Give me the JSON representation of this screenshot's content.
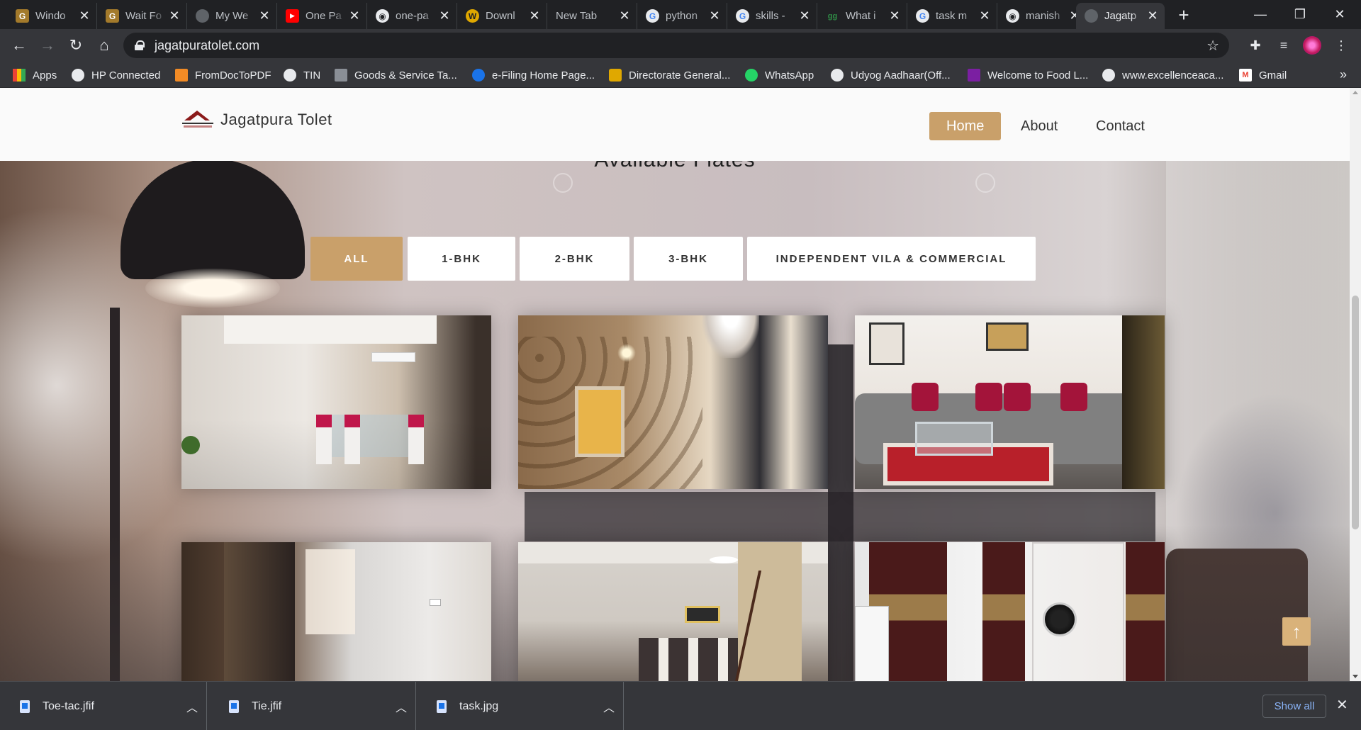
{
  "browser": {
    "tabs": [
      {
        "label": "Windo",
        "favicon_text": "G",
        "favicon_color": "#a37a2b"
      },
      {
        "label": "Wait Fo",
        "favicon_text": "G",
        "favicon_color": "#a37a2b"
      },
      {
        "label": "My We",
        "favicon_text": "",
        "favicon_color": "#5f6368"
      },
      {
        "label": "One Pa",
        "favicon_text": "▶",
        "favicon_color": "#ff0000"
      },
      {
        "label": "one-pa",
        "favicon_text": "◉",
        "favicon_color": "#202124"
      },
      {
        "label": "Downl",
        "favicon_text": "W",
        "favicon_color": "#e0a800"
      },
      {
        "label": "New Tab",
        "favicon_text": "",
        "favicon_color": "transparent"
      },
      {
        "label": "python",
        "favicon_text": "G",
        "favicon_color": "#4285f4"
      },
      {
        "label": "skills -",
        "favicon_text": "G",
        "favicon_color": "#4285f4"
      },
      {
        "label": "What i",
        "favicon_text": "gg",
        "favicon_color": "#2f8d46"
      },
      {
        "label": "task m",
        "favicon_text": "G",
        "favicon_color": "#4285f4"
      },
      {
        "label": "manish",
        "favicon_text": "◉",
        "favicon_color": "#202124"
      },
      {
        "label": "Jagatp",
        "favicon_text": "",
        "favicon_color": "#5f6368"
      }
    ],
    "new_tab_label": "+",
    "window_controls": {
      "minimize": "—",
      "restore": "❐",
      "close": "✕"
    },
    "url": "jagatpuratolet.com",
    "icons": {
      "back": "back-arrow-icon",
      "forward": "forward-arrow-icon",
      "reload": "reload-icon",
      "home": "home-icon",
      "star": "bookmark-star-icon",
      "extensions": "puzzle-icon",
      "media": "media-queue-icon",
      "menu": "kebab-menu-icon"
    },
    "bookmarks": [
      {
        "label": "Apps",
        "icon_color": "#ea4335"
      },
      {
        "label": "HP Connected",
        "icon_color": "#5f6368"
      },
      {
        "label": "FromDocToPDF",
        "icon_color": "#f28b25"
      },
      {
        "label": "TIN",
        "icon_color": "#5f6368"
      },
      {
        "label": "Goods & Service Ta...",
        "icon_color": "#8a8f96"
      },
      {
        "label": "e-Filing Home Page...",
        "icon_color": "#1a73e8"
      },
      {
        "label": "Directorate General...",
        "icon_color": "#e0a800"
      },
      {
        "label": "WhatsApp",
        "icon_color": "#25d366"
      },
      {
        "label": "Udyog Aadhaar(Off...",
        "icon_color": "#5f6368"
      },
      {
        "label": "Welcome to Food L...",
        "icon_color": "#7b1fa2"
      },
      {
        "label": "www.excellenceaca...",
        "icon_color": "#5f6368"
      },
      {
        "label": "Gmail",
        "icon_color": "#ea4335"
      }
    ],
    "bookmarks_overflow": "»"
  },
  "site": {
    "brand": "Jagatpura Tolet",
    "nav": [
      {
        "label": "Home",
        "active": true
      },
      {
        "label": "About",
        "active": false
      },
      {
        "label": "Contact",
        "active": false
      }
    ],
    "accent_color": "#c9a06a",
    "section_title": "Available Flates",
    "filters": [
      {
        "label": "ALL",
        "active": true
      },
      {
        "label": "1-BHK",
        "active": false
      },
      {
        "label": "2-BHK",
        "active": false
      },
      {
        "label": "3-BHK",
        "active": false
      },
      {
        "label": "INDEPENDENT VILA & COMMERCIAL",
        "active": false
      }
    ],
    "gallery": [
      {
        "photo": "dining-room-photo"
      },
      {
        "photo": "wallpaper-living-room-photo"
      },
      {
        "photo": "sofa-living-room-photo"
      },
      {
        "photo": "bedroom-door-photo"
      },
      {
        "photo": "hall-cabinet-photo"
      },
      {
        "photo": "curtains-fridge-photo"
      }
    ],
    "back_to_top_icon": "↑"
  },
  "downloads": {
    "items": [
      {
        "filename": "Toe-tac.jfif"
      },
      {
        "filename": "Tie.jfif"
      },
      {
        "filename": "task.jpg"
      }
    ],
    "show_all_label": "Show all",
    "close_label": "✕"
  }
}
